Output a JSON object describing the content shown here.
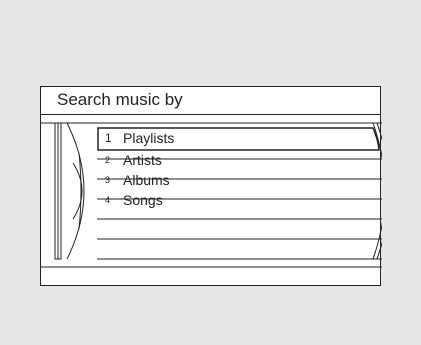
{
  "header": {
    "title": "Search music by"
  },
  "menu": {
    "items": [
      {
        "number": "1",
        "label": "Playlists",
        "selected": true
      },
      {
        "number": "2",
        "label": "Artists",
        "selected": false
      },
      {
        "number": "3",
        "label": "Albums",
        "selected": false
      },
      {
        "number": "4",
        "label": "Songs",
        "selected": false
      }
    ]
  },
  "colors": {
    "background": "#e6e6e6",
    "screen": "#ffffff",
    "lines": "#222222"
  },
  "icons": {
    "left_decoration": "disc-wheel-icon",
    "right_decoration": "scroll-curve-icon"
  }
}
